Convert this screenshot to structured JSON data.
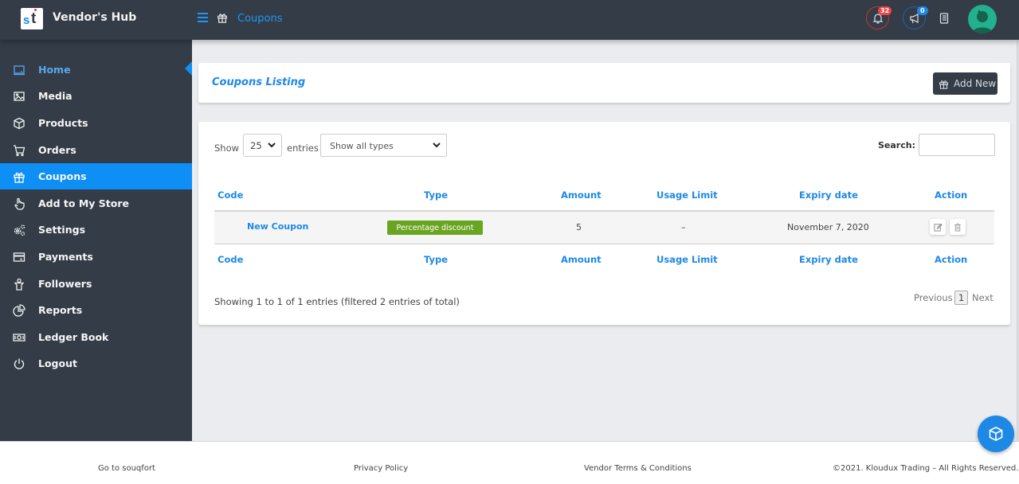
{
  "header": {
    "brand": "Vendor's Hub",
    "logo_letters": [
      "s",
      "t"
    ],
    "breadcrumb_icon": "gift-icon",
    "breadcrumb_label": "Coupons",
    "notifications": {
      "icon": "bell-icon",
      "count": "32",
      "color": "#ef4444"
    },
    "announcements": {
      "icon": "megaphone-icon",
      "count": "0",
      "color": "#1e88e5"
    },
    "knowledgebase_icon": "book-icon",
    "avatar_icon": "user-avatar-icon"
  },
  "sidebar": {
    "items": [
      {
        "label": "Home",
        "icon": "laptop-icon",
        "state": "current-page"
      },
      {
        "label": "Media",
        "icon": "image-icon"
      },
      {
        "label": "Products",
        "icon": "cube-icon"
      },
      {
        "label": "Orders",
        "icon": "cart-icon"
      },
      {
        "label": "Coupons",
        "icon": "gift-icon",
        "state": "active"
      },
      {
        "label": "Add to My Store",
        "icon": "hand-pointer-icon"
      },
      {
        "label": "Settings",
        "icon": "cogs-icon"
      },
      {
        "label": "Payments",
        "icon": "credit-card-icon"
      },
      {
        "label": "Followers",
        "icon": "followers-icon"
      },
      {
        "label": "Reports",
        "icon": "pie-chart-icon"
      },
      {
        "label": "Ledger Book",
        "icon": "money-icon"
      },
      {
        "label": "Logout",
        "icon": "power-icon"
      }
    ]
  },
  "listing": {
    "title": "Coupons Listing",
    "add_new_label": "Add New"
  },
  "table_controls": {
    "show_label": "Show",
    "page_length": "25",
    "entries_label": "entries",
    "type_filter": "Show all types",
    "search_label": "Search:",
    "search_value": ""
  },
  "table": {
    "columns": [
      "Code",
      "Type",
      "Amount",
      "Usage Limit",
      "Expiry date",
      "Action"
    ],
    "rows": [
      {
        "code": "New Coupon",
        "type": "Percentage discount",
        "amount": "5",
        "usage_limit": "–",
        "expiry_date": "November 7, 2020",
        "actions": [
          "edit-icon",
          "trash-icon"
        ]
      }
    ],
    "type_badge_color": "#6aa521"
  },
  "pagination": {
    "info": "Showing 1 to 1 of 1 entries (filtered 2 entries of total)",
    "previous": "Previous",
    "current_page": "1",
    "next": "Next"
  },
  "footer": {
    "links": [
      "Go to souqfort",
      "Privacy Policy",
      "Vendor Terms & Conditions"
    ],
    "copyright": "©2021. Kloudux Trading – All Rights Reserved."
  },
  "fab_icon": "cube-icon",
  "colors": {
    "accent": "#1e88e5",
    "sidebar_bg": "#343c47",
    "active_item": "#0e8ff5"
  }
}
